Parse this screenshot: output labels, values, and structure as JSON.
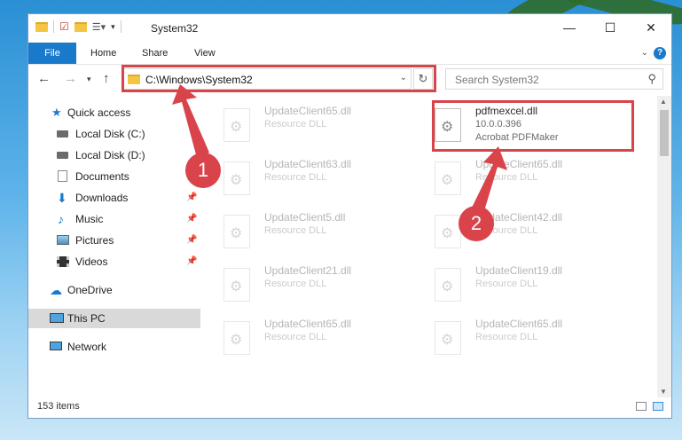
{
  "window": {
    "title": "System32"
  },
  "ribbon": {
    "tabs": [
      "File",
      "Home",
      "Share",
      "View"
    ],
    "help": "?"
  },
  "address": {
    "path": "C:\\Windows\\System32",
    "search_placeholder": "Search System32"
  },
  "sidebar": {
    "items": [
      {
        "label": "Quick access",
        "icon": "star-icon",
        "pinned": false
      },
      {
        "label": "Local Disk (C:)",
        "icon": "drive-icon",
        "pinned": false
      },
      {
        "label": "Local Disk (D:)",
        "icon": "drive-icon",
        "pinned": false
      },
      {
        "label": "Documents",
        "icon": "documents-icon",
        "pinned": true
      },
      {
        "label": "Downloads",
        "icon": "downloads-icon",
        "pinned": true
      },
      {
        "label": "Music",
        "icon": "music-icon",
        "pinned": true
      },
      {
        "label": "Pictures",
        "icon": "pictures-icon",
        "pinned": true
      },
      {
        "label": "Videos",
        "icon": "videos-icon",
        "pinned": true
      },
      {
        "label": "OneDrive",
        "icon": "cloud-icon",
        "pinned": false
      },
      {
        "label": "This PC",
        "icon": "computer-icon",
        "pinned": false,
        "selected": true
      },
      {
        "label": "Network",
        "icon": "network-icon",
        "pinned": false
      }
    ]
  },
  "files": {
    "left": [
      {
        "name": "UpdateClient65.dll",
        "type": "Resource DLL"
      },
      {
        "name": "UpdateClient63.dll",
        "type": "Resource DLL"
      },
      {
        "name": "UpdateClient5.dll",
        "type": "Resource DLL"
      },
      {
        "name": "UpdateClient21.dll",
        "type": "Resource DLL"
      },
      {
        "name": "UpdateClient65.dll",
        "type": "Resource DLL"
      }
    ],
    "right": [
      {
        "name": "pdfmexcel.dll",
        "type": "10.0.0.396",
        "extra": "Acrobat PDFMaker",
        "highlighted": true
      },
      {
        "name": "UpdateClient65.dll",
        "type": "Resource DLL"
      },
      {
        "name": "UpdateClient42.dll",
        "type": "Resource DLL"
      },
      {
        "name": "UpdateClient19.dll",
        "type": "Resource DLL"
      },
      {
        "name": "UpdateClient65.dll",
        "type": "Resource DLL"
      }
    ]
  },
  "status": {
    "count": "153 items"
  },
  "callouts": [
    "1",
    "2"
  ],
  "colors": {
    "accent": "#1979ca",
    "callout": "#d9434a",
    "selected": "#d9d9d9"
  }
}
